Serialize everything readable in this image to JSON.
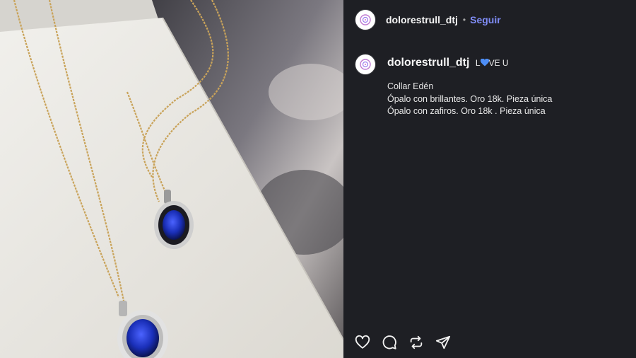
{
  "post": {
    "username": "dolorestrull_dtj",
    "separator": "•",
    "follow_label": "Seguir"
  },
  "caption": {
    "username": "dolorestrull_dtj",
    "prefix": "L",
    "suffix": "VE U",
    "lines": [
      "Collar Edén",
      "Ópalo con brillantes. Oro 18k. Pieza única",
      "Ópalo con zafiros. Oro 18k . Pieza única"
    ]
  },
  "colors": {
    "background": "#1e1f24",
    "follow": "#7f8cf5",
    "heart": "#4e8ef7"
  },
  "icons": [
    "avatar-logo-icon",
    "heart-icon",
    "comment-icon",
    "repost-icon",
    "share-icon"
  ]
}
